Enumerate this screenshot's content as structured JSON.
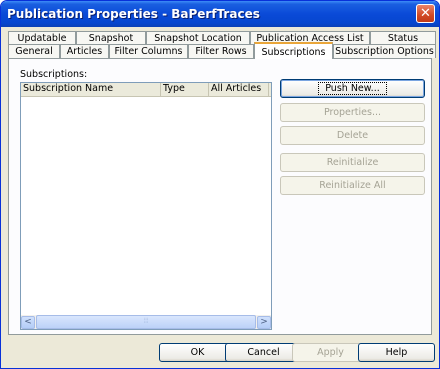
{
  "window": {
    "title": "Publication Properties - BaPerfTraces",
    "close_icon": "close-icon"
  },
  "tabs": {
    "back": [
      "Updatable",
      "Snapshot",
      "Snapshot Location",
      "Publication Access List",
      "Status"
    ],
    "front": [
      "General",
      "Articles",
      "Filter Columns",
      "Filter Rows",
      "Subscriptions",
      "Subscription Options"
    ],
    "selected": "Subscriptions"
  },
  "subscriptions": {
    "label": "Subscriptions:",
    "columns": [
      "Subscription Name",
      "Type",
      "All Articles"
    ],
    "rows": [],
    "scroll_left": "<",
    "scroll_right": ">"
  },
  "side_buttons": {
    "push_new": "Push New...",
    "properties": "Properties...",
    "delete": "Delete",
    "reinitialize": "Reinitialize",
    "reinitialize_all": "Reinitialize All"
  },
  "footer": {
    "ok": "OK",
    "cancel": "Cancel",
    "apply": "Apply",
    "help": "Help"
  }
}
